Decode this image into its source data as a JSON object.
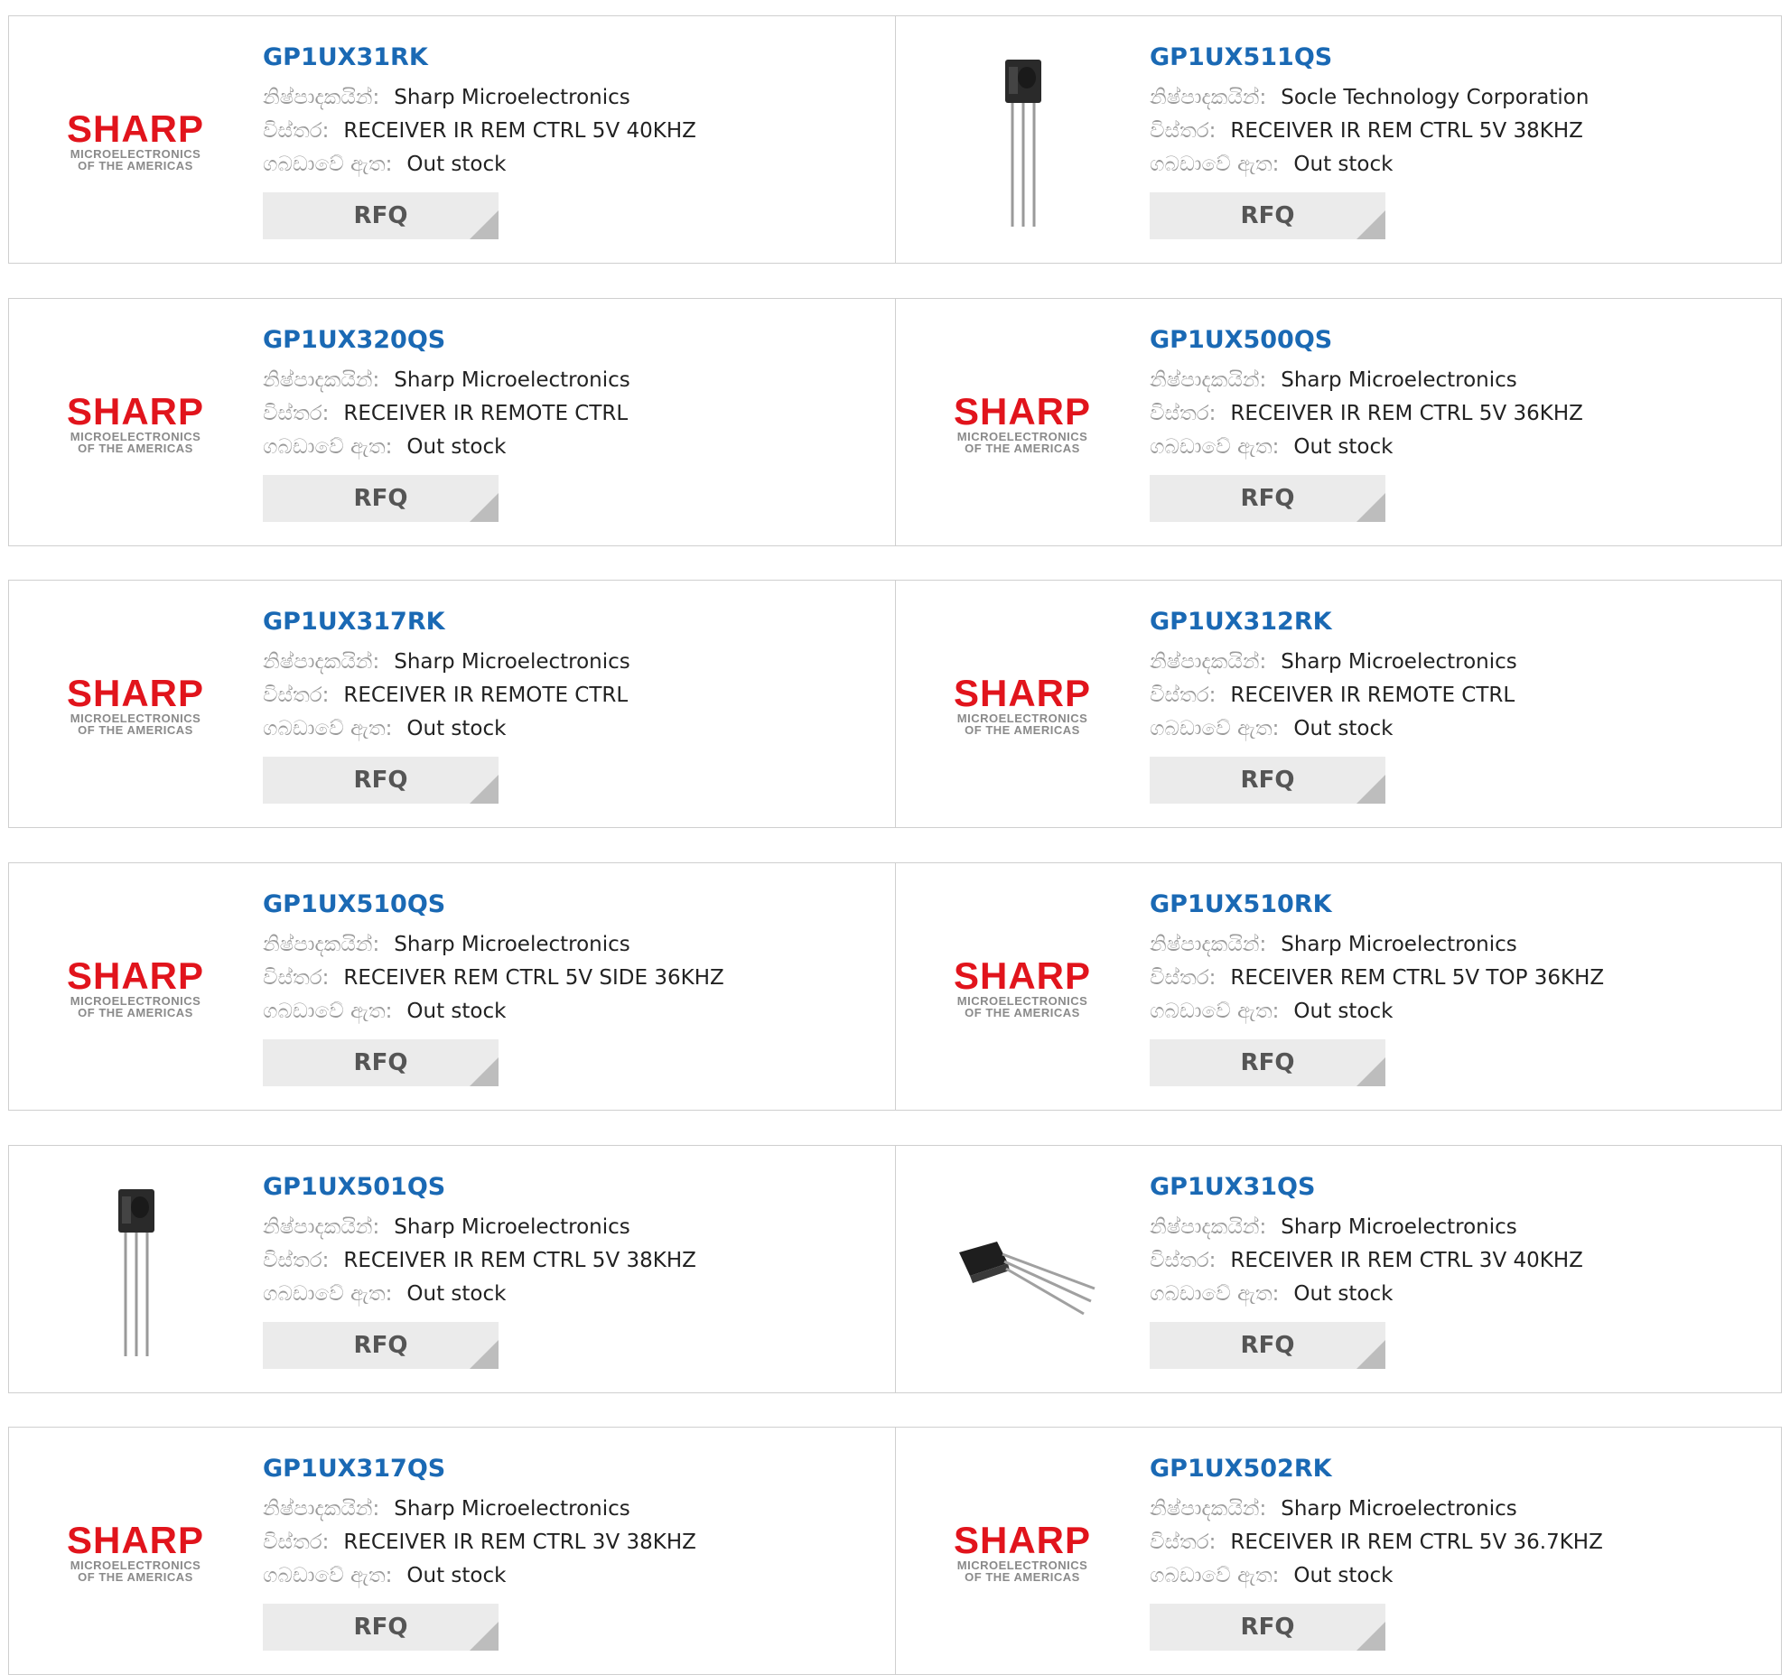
{
  "labels": {
    "manufacturer": "නිෂ්පාදකයින්:",
    "description": "විස්තර:",
    "stock": "ගබඩාවේ ඇත:"
  },
  "logo": {
    "word": "SHARP",
    "line1": "MICROELECTRONICS",
    "line2": "OF THE AMERICAS",
    "color": "#e1141c"
  },
  "rfq_label": "RFQ",
  "colors": {
    "part_link": "#1a69b4",
    "button_bg": "#ebebeb"
  },
  "products": [
    {
      "part": "GP1UX31RK",
      "manufacturer": "Sharp Microelectronics",
      "description": "RECEIVER IR REM CTRL 5V 40KHZ",
      "stock": "Out stock",
      "image": "sharp-logo"
    },
    {
      "part": "GP1UX511QS",
      "manufacturer": "Socle Technology Corporation",
      "description": "RECEIVER IR REM CTRL 5V 38KHZ",
      "stock": "Out stock",
      "image": "ir-receiver-vertical"
    },
    {
      "part": "GP1UX320QS",
      "manufacturer": "Sharp Microelectronics",
      "description": "RECEIVER IR REMOTE CTRL",
      "stock": "Out stock",
      "image": "sharp-logo"
    },
    {
      "part": "GP1UX500QS",
      "manufacturer": "Sharp Microelectronics",
      "description": "RECEIVER IR REM CTRL 5V 36KHZ",
      "stock": "Out stock",
      "image": "sharp-logo"
    },
    {
      "part": "GP1UX317RK",
      "manufacturer": "Sharp Microelectronics",
      "description": "RECEIVER IR REMOTE CTRL",
      "stock": "Out stock",
      "image": "sharp-logo"
    },
    {
      "part": "GP1UX312RK",
      "manufacturer": "Sharp Microelectronics",
      "description": "RECEIVER IR REMOTE CTRL",
      "stock": "Out stock",
      "image": "sharp-logo"
    },
    {
      "part": "GP1UX510QS",
      "manufacturer": "Sharp Microelectronics",
      "description": "RECEIVER REM CTRL 5V SIDE 36KHZ",
      "stock": "Out stock",
      "image": "sharp-logo"
    },
    {
      "part": "GP1UX510RK",
      "manufacturer": "Sharp Microelectronics",
      "description": "RECEIVER REM CTRL 5V TOP 36KHZ",
      "stock": "Out stock",
      "image": "sharp-logo"
    },
    {
      "part": "GP1UX501QS",
      "manufacturer": "Sharp Microelectronics",
      "description": "RECEIVER IR REM CTRL 5V 38KHZ",
      "stock": "Out stock",
      "image": "ir-receiver-vertical"
    },
    {
      "part": "GP1UX31QS",
      "manufacturer": "Sharp Microelectronics",
      "description": "RECEIVER IR REM CTRL 3V 40KHZ",
      "stock": "Out stock",
      "image": "ir-receiver-angled"
    },
    {
      "part": "GP1UX317QS",
      "manufacturer": "Sharp Microelectronics",
      "description": "RECEIVER IR REM CTRL 3V 38KHZ",
      "stock": "Out stock",
      "image": "sharp-logo"
    },
    {
      "part": "GP1UX502RK",
      "manufacturer": "Sharp Microelectronics",
      "description": "RECEIVER IR REM CTRL 5V 36.7KHZ",
      "stock": "Out stock",
      "image": "sharp-logo"
    }
  ]
}
